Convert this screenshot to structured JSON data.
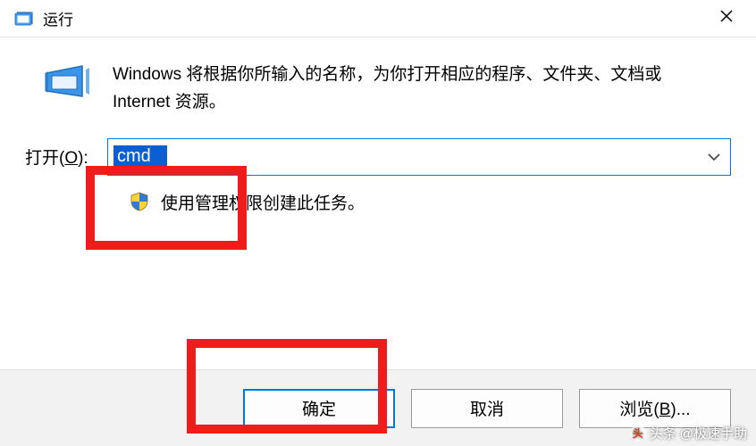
{
  "titlebar": {
    "title": "运行"
  },
  "description": "Windows 将根据你所输入的名称，为你打开相应的程序、文件夹、文档或 Internet 资源。",
  "open": {
    "label_prefix": "打开(",
    "label_hotkey": "O",
    "label_suffix": "):",
    "value": "cmd"
  },
  "admin_note": "使用管理权限创建此任务。",
  "buttons": {
    "ok": "确定",
    "cancel": "取消",
    "browse_prefix": "浏览(",
    "browse_hotkey": "B",
    "browse_suffix": ")..."
  },
  "watermark": {
    "prefix": "头条",
    "author": "@极速手助"
  }
}
